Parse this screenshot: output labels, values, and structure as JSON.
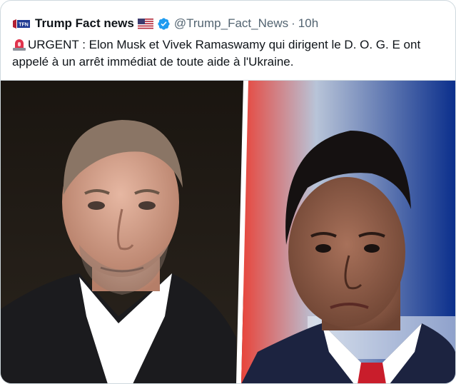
{
  "tweet": {
    "display_name": "Trump Fact news",
    "handle": "@Trump_Fact_News",
    "separator": "·",
    "time": "10h",
    "avatar_text": "TFN",
    "text": "URGENT : Elon Musk et Vivek Ramaswamy qui dirigent le D. O. G. E ont appelé à un arrêt immédiat de toute aide à l'Ukraine.",
    "icons": {
      "flag": "us-flag-icon",
      "verified": "verified-badge-icon",
      "alert": "siren-icon"
    },
    "colors": {
      "verified": "#1d9bf0",
      "muted": "#536471",
      "text": "#0f1419"
    }
  }
}
